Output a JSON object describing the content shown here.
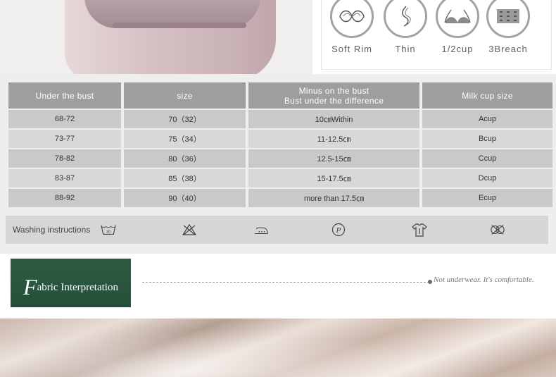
{
  "features": [
    {
      "label": "Soft Rim",
      "icon": "soft-rim-icon"
    },
    {
      "label": "Thin",
      "icon": "thin-icon"
    },
    {
      "label": "1/2cup",
      "icon": "half-cup-icon"
    },
    {
      "label": "3Breach",
      "icon": "hook-eye-icon"
    }
  ],
  "size_table": {
    "headers": [
      "Under the bust",
      "size",
      "Minus on the bust",
      "Bust under the difference",
      "Milk cup size"
    ],
    "rows": [
      [
        "68-72",
        "70（32）",
        "10㎝Within",
        "Acup"
      ],
      [
        "73-77",
        "75（34）",
        "11-12.5㎝",
        "Bcup"
      ],
      [
        "78-82",
        "80（36）",
        "12.5-15㎝",
        "Ccup"
      ],
      [
        "83-87",
        "85（38）",
        "15-17.5㎝",
        "Dcup"
      ],
      [
        "88-92",
        "90（40）",
        "more than 17.5㎝",
        "Ecup"
      ]
    ]
  },
  "washing": {
    "title": "Washing instructions",
    "wash_temp": "30",
    "icons": [
      "wash-30-icon",
      "no-bleach-icon",
      "iron-low-icon",
      "dry-clean-p-icon",
      "hang-dry-icon",
      "no-tumble-dry-icon"
    ]
  },
  "fabric": {
    "title_initial": "F",
    "title_rest": "abric Interpretation",
    "slogan": "Not underwear. It's comfortable."
  }
}
